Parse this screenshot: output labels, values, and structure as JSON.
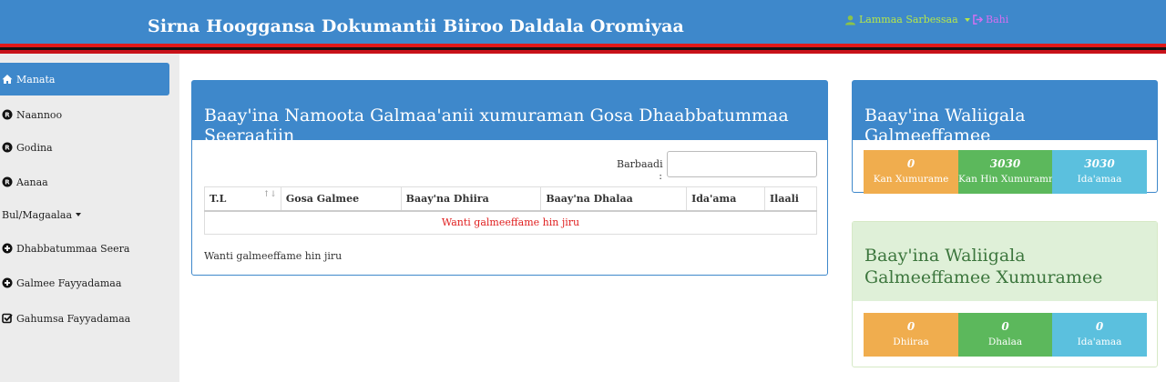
{
  "header": {
    "brand": "Sirna Hooggansa Dokumantii Biiroo Daldala Oromiyaa",
    "user_label": "Lammaa Sarbessaa",
    "logout_label": "Bahi"
  },
  "colors": {
    "primary": "#3e88cb",
    "stripe_red": "#e01818",
    "user_text": "#b5e64a",
    "logout_text": "#d46ff0",
    "orange": "#f0ad4e",
    "green": "#5cb85c",
    "cyan": "#5bc0de",
    "empty_text": "#e02020"
  },
  "sidebar": {
    "items": [
      {
        "label": "Manata",
        "icon": "home-icon"
      },
      {
        "label": "Naannoo",
        "icon": "registered-icon"
      },
      {
        "label": "Godina",
        "icon": "registered-icon"
      },
      {
        "label": "Aanaa",
        "icon": "registered-icon"
      },
      {
        "label": "Bul/Magaalaa"
      },
      {
        "label": "Dhabbatummaa Seera",
        "icon": "plus-circle-icon"
      },
      {
        "label": "Galmee Fayyadamaa",
        "icon": "plus-circle-icon"
      },
      {
        "label": "Gahumsa Fayyadamaa",
        "icon": "check-square-icon"
      }
    ]
  },
  "main": {
    "title": "Baay'ina Namoota Galmaa'anii xumuraman Gosa Dhaabbatummaa Seeraatiin",
    "search_label": "Barbaadi :",
    "search_value": "",
    "columns": [
      "T.L",
      "Gosa Galmee",
      "Baay'na Dhiira",
      "Baay'na Dhalaa",
      "Ida'ama",
      "Ilaali"
    ],
    "empty_message": "Wanti galmeeffame hin jiru",
    "info_text": "Wanti galmeeffame hin jiru"
  },
  "stats": {
    "title": "Baay'ina Waliigala Galmeeffamee",
    "cells": [
      {
        "value": "0",
        "label": "Kan Xumurame"
      },
      {
        "value": "3030",
        "label": "Kan Hin Xumuramne"
      },
      {
        "value": "3030",
        "label": "Ida'amaa"
      }
    ]
  },
  "completed": {
    "title": "Baay'ina Waliigala Galmeeffamee Xumuramee",
    "cells": [
      {
        "value": "0",
        "label": "Dhiiraa"
      },
      {
        "value": "0",
        "label": "Dhalaa"
      },
      {
        "value": "0",
        "label": "Ida'amaa"
      }
    ]
  }
}
